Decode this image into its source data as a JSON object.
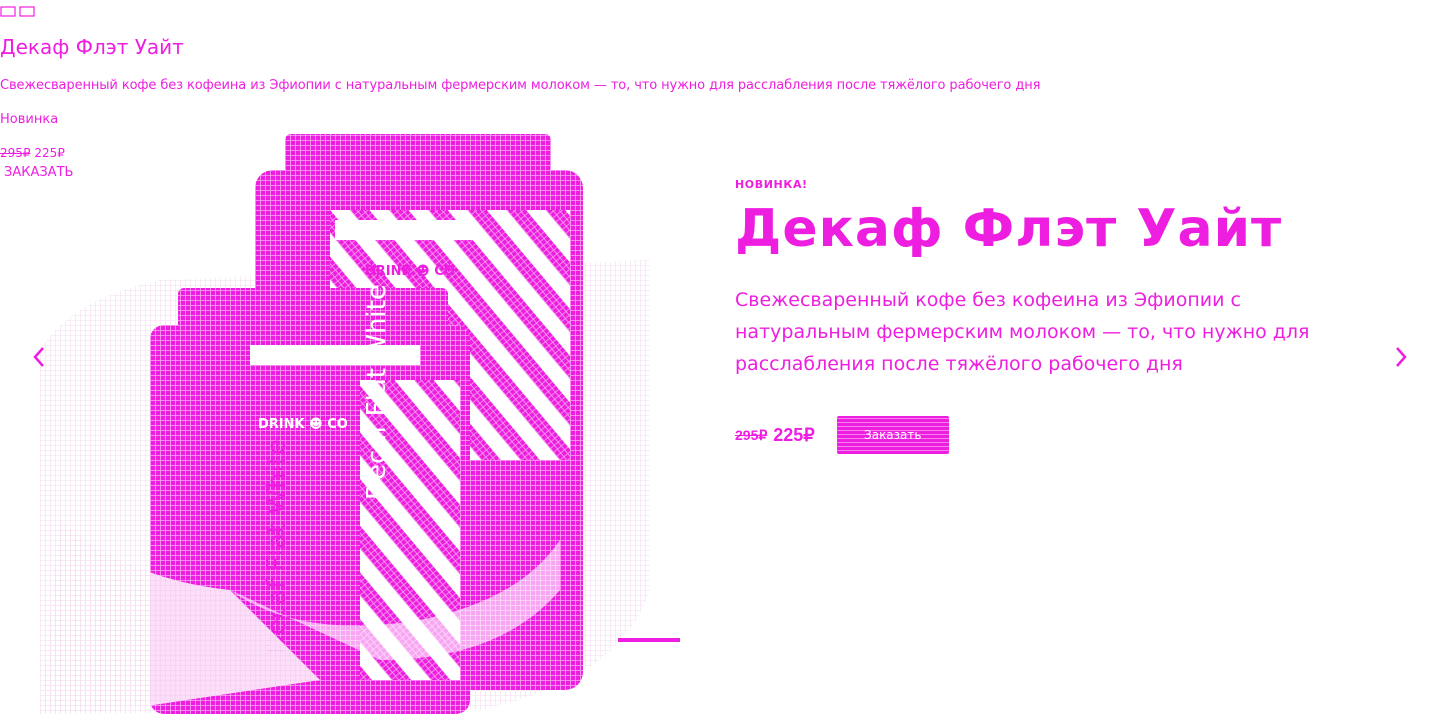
{
  "fallback": {
    "title": "Декаф Флэт Уайт",
    "description": "Свежесваренный кофе без кофеина из Эфиопии с натуральным фермерским молоком — то, что нужно для расслабления после тяжёлого рабочего дня",
    "tag": "Новинка",
    "price_old": "295₽",
    "price_new": "225₽",
    "order": "ЗАКАЗАТЬ"
  },
  "slide": {
    "badge": "НОВИНКА!",
    "title": "Декаф Флэт Уайт",
    "description": "Свежесваренный кофе без кофеина из Эфиопии с натуральным фермерским молоком — то, что нужно для расслабления после тяжёлого рабочего дня",
    "price_old": "295₽",
    "price_new": "225₽",
    "order_button": "Заказать"
  },
  "product": {
    "brand": "DRINK ☻ CO",
    "can_text": "Decaf Flat White"
  },
  "icons": {
    "prev": "chevron-left-icon",
    "next": "chevron-right-icon"
  },
  "colors": {
    "accent": "#ee1ee0",
    "background": "#ffffff"
  }
}
